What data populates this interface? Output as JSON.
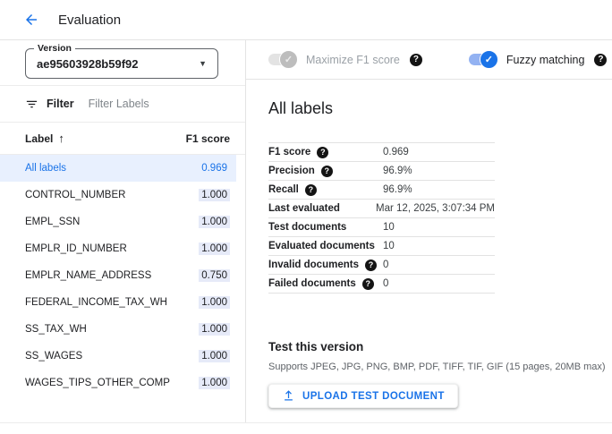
{
  "header": {
    "title": "Evaluation"
  },
  "left_panel": {
    "version": {
      "label": "Version",
      "value": "ae95603928b59f92"
    },
    "filter": {
      "label": "Filter",
      "placeholder": "Filter Labels"
    },
    "table": {
      "columns": {
        "label": "Label",
        "score": "F1 score"
      },
      "rows": [
        {
          "label": "All labels",
          "score": "0.969"
        },
        {
          "label": "CONTROL_NUMBER",
          "score": "1.000"
        },
        {
          "label": "EMPL_SSN",
          "score": "1.000"
        },
        {
          "label": "EMPLR_ID_NUMBER",
          "score": "1.000"
        },
        {
          "label": "EMPLR_NAME_ADDRESS",
          "score": "0.750"
        },
        {
          "label": "FEDERAL_INCOME_TAX_WH",
          "score": "1.000"
        },
        {
          "label": "SS_TAX_WH",
          "score": "1.000"
        },
        {
          "label": "SS_WAGES",
          "score": "1.000"
        },
        {
          "label": "WAGES_TIPS_OTHER_COMP",
          "score": "1.000"
        }
      ]
    }
  },
  "toggles": {
    "maximize_f1": {
      "label": "Maximize F1 score",
      "state": "on-disabled"
    },
    "fuzzy_matching": {
      "label": "Fuzzy matching",
      "state": "on"
    }
  },
  "details": {
    "heading": "All labels",
    "metrics": [
      {
        "label": "F1 score",
        "value": "0.969"
      },
      {
        "label": "Precision",
        "value": "96.9%"
      },
      {
        "label": "Recall",
        "value": "96.9%"
      },
      {
        "label": "Last evaluated",
        "value": "Mar 12, 2025, 3:07:34 PM"
      },
      {
        "label": "Test documents",
        "value": "10"
      },
      {
        "label": "Evaluated documents",
        "value": "10"
      },
      {
        "label": "Invalid documents",
        "value": "0"
      },
      {
        "label": "Failed documents",
        "value": "0"
      }
    ]
  },
  "test_section": {
    "heading": "Test this version",
    "supports": "Supports JPEG, JPG, PNG, BMP, PDF, TIFF, TIF, GIF (15 pages, 20MB max)",
    "upload_button": "UPLOAD TEST DOCUMENT"
  },
  "icons": {
    "help": "?",
    "sort_asc": "↑",
    "caret": "▼",
    "check": "✓"
  },
  "colors": {
    "accent": "#1a73e8",
    "selected_row_bg": "#e8f0fe",
    "score_highlight": "#e6eaf8"
  }
}
